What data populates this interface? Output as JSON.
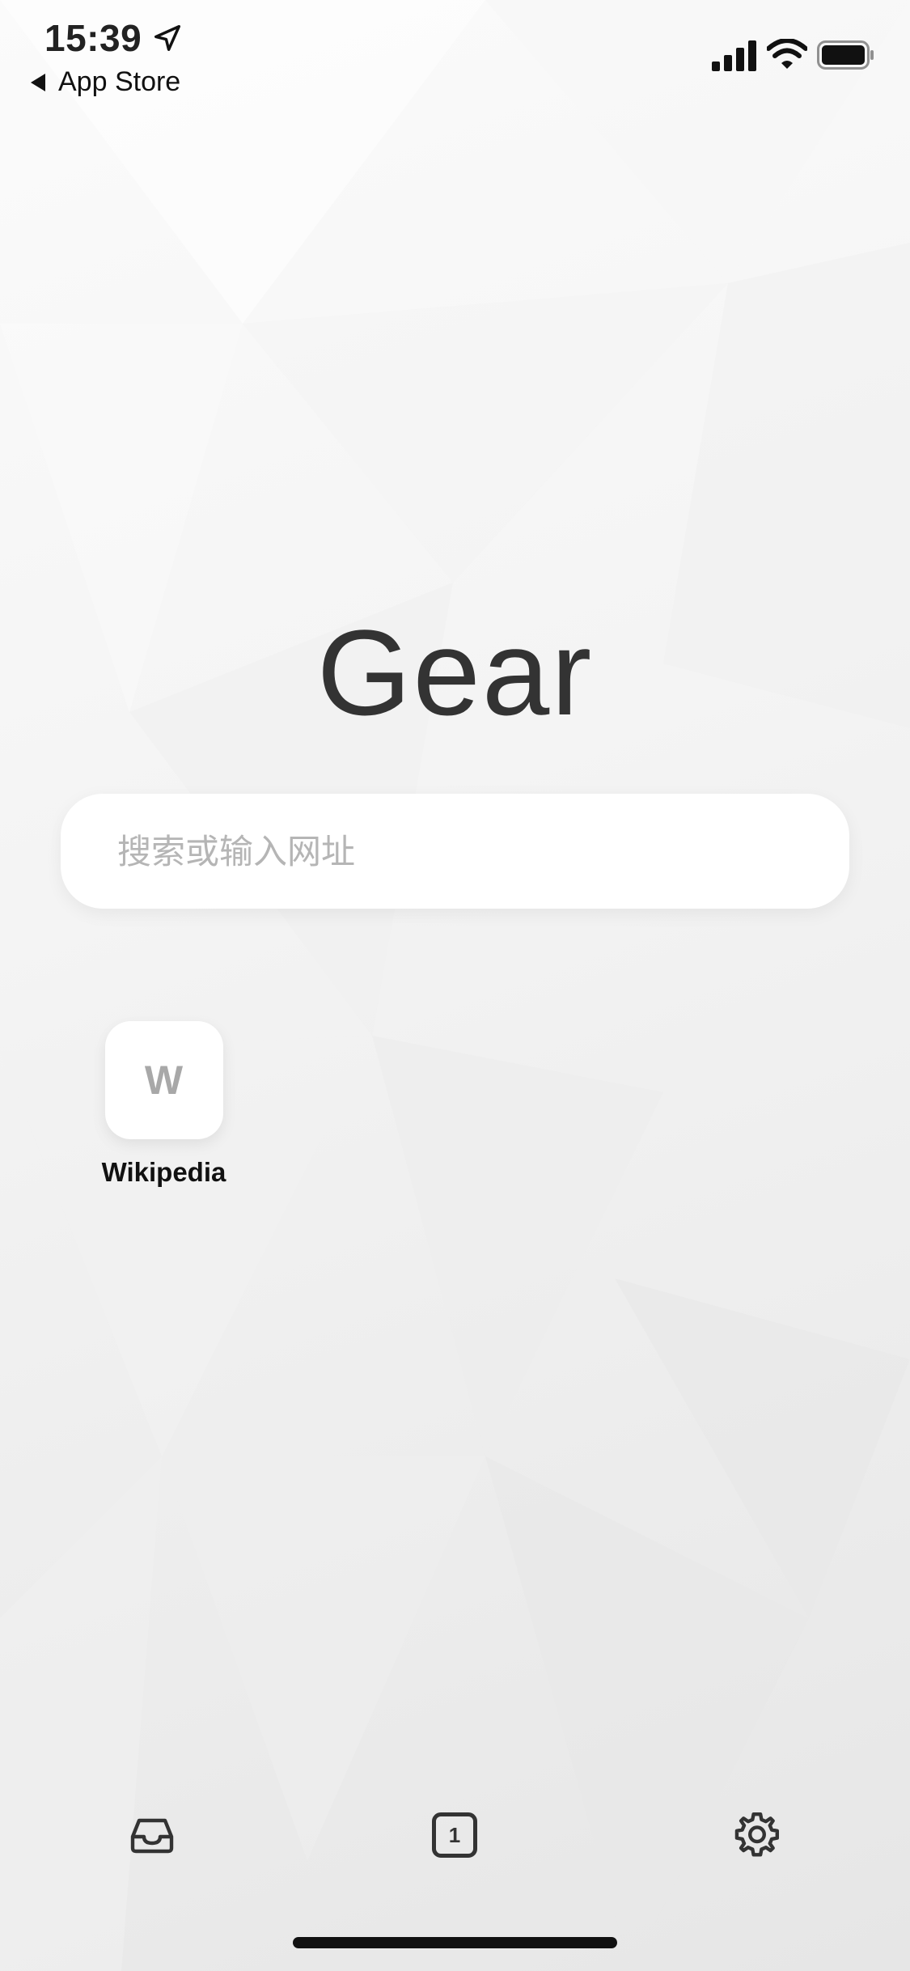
{
  "status_bar": {
    "time": "15:39",
    "back_label": "App Store"
  },
  "app": {
    "title": "Gear"
  },
  "search": {
    "placeholder": "搜索或输入网址"
  },
  "shortcuts": [
    {
      "letter": "W",
      "label": "Wikipedia"
    }
  ],
  "toolbar": {
    "inbox_icon": "tray-icon",
    "tab_count": "1",
    "settings_icon": "gear-icon"
  },
  "colors": {
    "title": "#333333",
    "placeholder": "#b5b5b5",
    "icon": "#333333"
  }
}
